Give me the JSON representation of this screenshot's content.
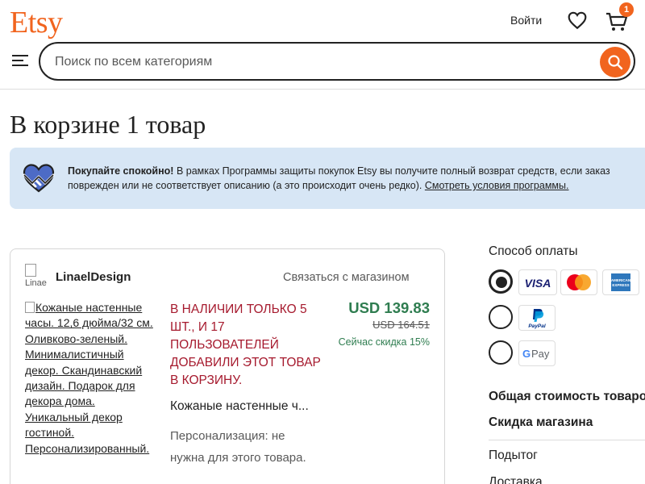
{
  "header": {
    "logo": "Etsy",
    "signin_label": "Войти",
    "cart_count": "1",
    "search_placeholder": "Поиск по всем категориям",
    "brand_color": "#f1641e"
  },
  "page_title": "В корзине 1 товар",
  "banner": {
    "bold": "Покупайте спокойно!",
    "text_line1": " В рамках Программы защиты покупок Etsy вы получите полный возврат средств, если заказ",
    "text_line2": "поврежден или не соответствует описанию (а это происходит очень редко). ",
    "link": "Смотреть условия программы."
  },
  "cart_item": {
    "shop_avatar_alt": "Linae",
    "shop_name": "LinaelDesign",
    "contact_shop": "Связаться с магазином",
    "image_alt": "Кожаные настенные часы. 12,6 дюйма/32 см. Оливково-зеленый. Минималистичный декор. Скандинавский дизайн. Подарок для декора дома. Уникальный декор гостиной. Персонализированный.",
    "stock_warning": "В НАЛИЧИИ ТОЛЬКО 5 ШТ., И 17 ПОЛЬЗОВАТЕЛЕЙ ДОБАВИЛИ ЭТОТ ТОВАР В КОРЗИНУ.",
    "title": "Кожаные настенные ч...",
    "personalization": "Персонализация: не нужна для этого товара.",
    "price_now": "USD 139.83",
    "price_old": "USD 164.51",
    "discount": "Сейчас скидка 15%"
  },
  "payment": {
    "title": "Способ оплаты",
    "methods": [
      {
        "name": "VISA",
        "selected": true
      },
      {
        "name": "Mastercard"
      },
      {
        "name": "AMERICAN EXPRESS"
      },
      {
        "name": "PayPal"
      },
      {
        "name": "G Pay"
      }
    ]
  },
  "summary": {
    "total_label": "Общая стоимость товаров",
    "shop_discount": "Скидка магазина",
    "subtotal": "Подытог",
    "delivery": "Доставка"
  }
}
